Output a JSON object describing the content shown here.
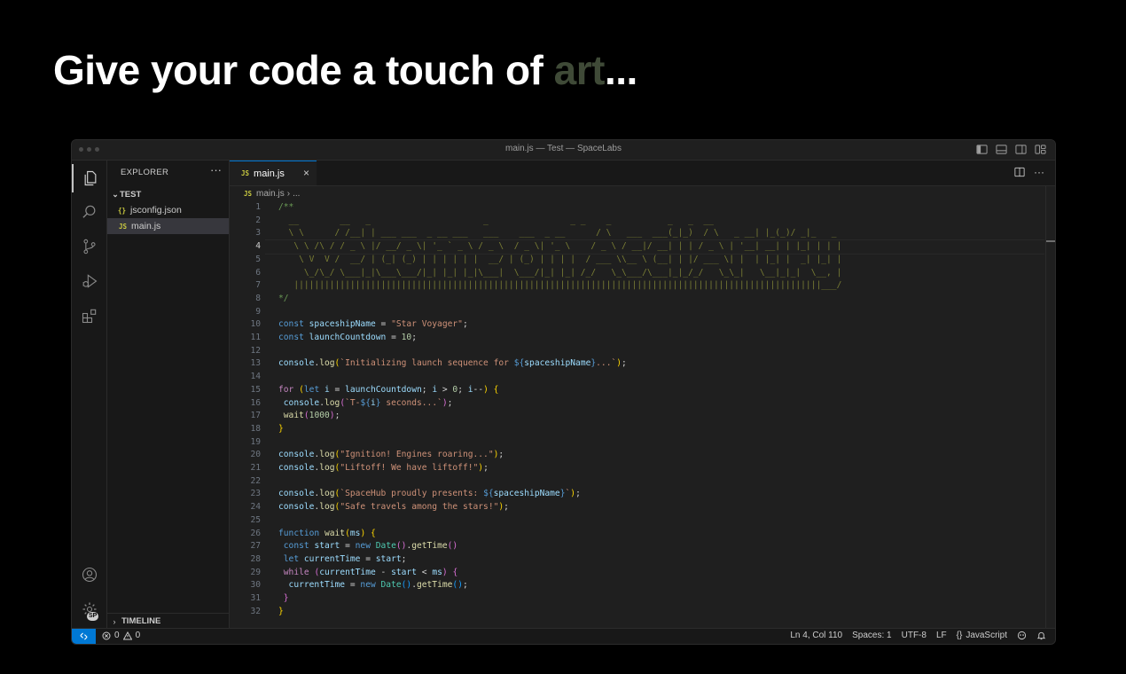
{
  "headline": {
    "text_before": "Give your code a touch of ",
    "accent": "art",
    "text_after": "..."
  },
  "window": {
    "title": "main.js — Test — SpaceLabs"
  },
  "activity": {
    "account_badge": "SP"
  },
  "sidebar": {
    "header": "EXPLORER",
    "more": "···",
    "folder": "TEST",
    "files": [
      {
        "icon": "{}",
        "name": "jsconfig.json"
      },
      {
        "icon": "JS",
        "name": "main.js"
      }
    ],
    "timeline": "TIMELINE"
  },
  "tab": {
    "icon": "JS",
    "label": "main.js",
    "close": "×"
  },
  "editor_actions": {
    "more": "···"
  },
  "breadcrumb": {
    "icon": "JS",
    "file": "main.js",
    "separator": "›",
    "rest": "..."
  },
  "code": {
    "cursor_line": 4,
    "lines": [
      [
        {
          "t": "/**",
          "c": "cm"
        }
      ],
      [
        {
          "t": "  __        __   _                      _                _ _    _           _   _  __",
          "c": "ascii"
        }
      ],
      [
        {
          "t": "  \\ \\      / /__| | ___ ___  _ __ ___   ___    ___  _ __      / \\   ___  ___(_|_)  / \\   _ __| |_(_)/ _|_   _",
          "c": "ascii"
        }
      ],
      [
        {
          "t": "   \\ \\ /\\ / / _ \\ |/ __/ _ \\| '_ ` _ \\ / _ \\  / _ \\| '_ \\    / _ \\ / __|/ __| | | / _ \\ | '__| __| | |_| | | |",
          "c": "ascii"
        }
      ],
      [
        {
          "t": "    \\ V  V /  __/ | (_| (_) | | | | | |  __/ | (_) | | | |  / ___ \\\\__ \\ (__| | |/ ___ \\| |  | |_| |  _| |_| |",
          "c": "ascii"
        }
      ],
      [
        {
          "t": "     \\_/\\_/ \\___|_|\\___\\___/|_| |_| |_|\\___|  \\___/|_| |_| /_/   \\_\\___/\\___|_|_/_/   \\_\\_|   \\__|_|_|  \\__, |",
          "c": "ascii"
        }
      ],
      [
        {
          "t": "   |||||||||||||||||||||||||||||||||||||||||||||||||||||||||||||||||||||||||||||||||||||||||||||||||||||||___/",
          "c": "ascii"
        }
      ],
      [
        {
          "t": "*/",
          "c": "cm"
        }
      ],
      [],
      [
        {
          "t": "const ",
          "c": "kw"
        },
        {
          "t": "spaceshipName",
          "c": "var"
        },
        {
          "t": " = ",
          "c": "op"
        },
        {
          "t": "\"Star Voyager\"",
          "c": "str"
        },
        {
          "t": ";",
          "c": "op"
        }
      ],
      [
        {
          "t": "const ",
          "c": "kw"
        },
        {
          "t": "launchCountdown",
          "c": "var"
        },
        {
          "t": " = ",
          "c": "op"
        },
        {
          "t": "10",
          "c": "num"
        },
        {
          "t": ";",
          "c": "op"
        }
      ],
      [],
      [
        {
          "t": "console",
          "c": "var"
        },
        {
          "t": ".",
          "c": "op"
        },
        {
          "t": "log",
          "c": "fn"
        },
        {
          "t": "(",
          "c": "br1"
        },
        {
          "t": "`Initializing launch sequence for ",
          "c": "str"
        },
        {
          "t": "${",
          "c": "kw"
        },
        {
          "t": "spaceshipName",
          "c": "var"
        },
        {
          "t": "}",
          "c": "kw"
        },
        {
          "t": "...`",
          "c": "str"
        },
        {
          "t": ")",
          "c": "br1"
        },
        {
          "t": ";",
          "c": "op"
        }
      ],
      [],
      [
        {
          "t": "for ",
          "c": "ctl"
        },
        {
          "t": "(",
          "c": "br1"
        },
        {
          "t": "let ",
          "c": "kw"
        },
        {
          "t": "i",
          "c": "var"
        },
        {
          "t": " = ",
          "c": "op"
        },
        {
          "t": "launchCountdown",
          "c": "var"
        },
        {
          "t": "; ",
          "c": "op"
        },
        {
          "t": "i",
          "c": "var"
        },
        {
          "t": " > ",
          "c": "op"
        },
        {
          "t": "0",
          "c": "num"
        },
        {
          "t": "; ",
          "c": "op"
        },
        {
          "t": "i",
          "c": "var"
        },
        {
          "t": "--",
          "c": "op"
        },
        {
          "t": ")",
          "c": "br1"
        },
        {
          "t": " ",
          "c": "op"
        },
        {
          "t": "{",
          "c": "br1"
        }
      ],
      [
        {
          "t": " console",
          "c": "var"
        },
        {
          "t": ".",
          "c": "op"
        },
        {
          "t": "log",
          "c": "fn"
        },
        {
          "t": "(",
          "c": "br2"
        },
        {
          "t": "`T-",
          "c": "str"
        },
        {
          "t": "${",
          "c": "kw"
        },
        {
          "t": "i",
          "c": "var"
        },
        {
          "t": "}",
          "c": "kw"
        },
        {
          "t": " seconds...`",
          "c": "str"
        },
        {
          "t": ")",
          "c": "br2"
        },
        {
          "t": ";",
          "c": "op"
        }
      ],
      [
        {
          "t": " wait",
          "c": "fn"
        },
        {
          "t": "(",
          "c": "br2"
        },
        {
          "t": "1000",
          "c": "num"
        },
        {
          "t": ")",
          "c": "br2"
        },
        {
          "t": ";",
          "c": "op"
        }
      ],
      [
        {
          "t": "}",
          "c": "br1"
        }
      ],
      [],
      [
        {
          "t": "console",
          "c": "var"
        },
        {
          "t": ".",
          "c": "op"
        },
        {
          "t": "log",
          "c": "fn"
        },
        {
          "t": "(",
          "c": "br1"
        },
        {
          "t": "\"Ignition! Engines roaring...\"",
          "c": "str"
        },
        {
          "t": ")",
          "c": "br1"
        },
        {
          "t": ";",
          "c": "op"
        }
      ],
      [
        {
          "t": "console",
          "c": "var"
        },
        {
          "t": ".",
          "c": "op"
        },
        {
          "t": "log",
          "c": "fn"
        },
        {
          "t": "(",
          "c": "br1"
        },
        {
          "t": "\"Liftoff! We have liftoff!\"",
          "c": "str"
        },
        {
          "t": ")",
          "c": "br1"
        },
        {
          "t": ";",
          "c": "op"
        }
      ],
      [],
      [
        {
          "t": "console",
          "c": "var"
        },
        {
          "t": ".",
          "c": "op"
        },
        {
          "t": "log",
          "c": "fn"
        },
        {
          "t": "(",
          "c": "br1"
        },
        {
          "t": "`SpaceHub proudly presents: ",
          "c": "str"
        },
        {
          "t": "${",
          "c": "kw"
        },
        {
          "t": "spaceshipName",
          "c": "var"
        },
        {
          "t": "}",
          "c": "kw"
        },
        {
          "t": "`",
          "c": "str"
        },
        {
          "t": ")",
          "c": "br1"
        },
        {
          "t": ";",
          "c": "op"
        }
      ],
      [
        {
          "t": "console",
          "c": "var"
        },
        {
          "t": ".",
          "c": "op"
        },
        {
          "t": "log",
          "c": "fn"
        },
        {
          "t": "(",
          "c": "br1"
        },
        {
          "t": "\"Safe travels among the stars!\"",
          "c": "str"
        },
        {
          "t": ")",
          "c": "br1"
        },
        {
          "t": ";",
          "c": "op"
        }
      ],
      [],
      [
        {
          "t": "function ",
          "c": "kw"
        },
        {
          "t": "wait",
          "c": "fn"
        },
        {
          "t": "(",
          "c": "br1"
        },
        {
          "t": "ms",
          "c": "var"
        },
        {
          "t": ")",
          "c": "br1"
        },
        {
          "t": " ",
          "c": "op"
        },
        {
          "t": "{",
          "c": "br1"
        }
      ],
      [
        {
          "t": " const ",
          "c": "kw"
        },
        {
          "t": "start",
          "c": "var"
        },
        {
          "t": " = ",
          "c": "op"
        },
        {
          "t": "new ",
          "c": "kw"
        },
        {
          "t": "Date",
          "c": "cls"
        },
        {
          "t": "()",
          "c": "br2"
        },
        {
          "t": ".",
          "c": "op"
        },
        {
          "t": "getTime",
          "c": "fn"
        },
        {
          "t": "()",
          "c": "br2"
        }
      ],
      [
        {
          "t": " let ",
          "c": "kw"
        },
        {
          "t": "currentTime",
          "c": "var"
        },
        {
          "t": " = ",
          "c": "op"
        },
        {
          "t": "start",
          "c": "var"
        },
        {
          "t": ";",
          "c": "op"
        }
      ],
      [
        {
          "t": " while ",
          "c": "ctl"
        },
        {
          "t": "(",
          "c": "br2"
        },
        {
          "t": "currentTime",
          "c": "var"
        },
        {
          "t": " - ",
          "c": "op"
        },
        {
          "t": "start",
          "c": "var"
        },
        {
          "t": " < ",
          "c": "op"
        },
        {
          "t": "ms",
          "c": "var"
        },
        {
          "t": ")",
          "c": "br2"
        },
        {
          "t": " ",
          "c": "op"
        },
        {
          "t": "{",
          "c": "br2"
        }
      ],
      [
        {
          "t": "  currentTime",
          "c": "var"
        },
        {
          "t": " = ",
          "c": "op"
        },
        {
          "t": "new ",
          "c": "kw"
        },
        {
          "t": "Date",
          "c": "cls"
        },
        {
          "t": "()",
          "c": "br3"
        },
        {
          "t": ".",
          "c": "op"
        },
        {
          "t": "getTime",
          "c": "fn"
        },
        {
          "t": "()",
          "c": "br3"
        },
        {
          "t": ";",
          "c": "op"
        }
      ],
      [
        {
          "t": " }",
          "c": "br2"
        }
      ],
      [
        {
          "t": "}",
          "c": "br1"
        }
      ]
    ]
  },
  "status": {
    "errors": "0",
    "warnings": "0",
    "position": "Ln 4, Col 110",
    "spaces": "Spaces: 1",
    "encoding": "UTF-8",
    "eol": "LF",
    "language_icon": "{}",
    "language": "JavaScript"
  },
  "colors": {
    "accent": "#0078d4",
    "art": "#3f4a37"
  }
}
